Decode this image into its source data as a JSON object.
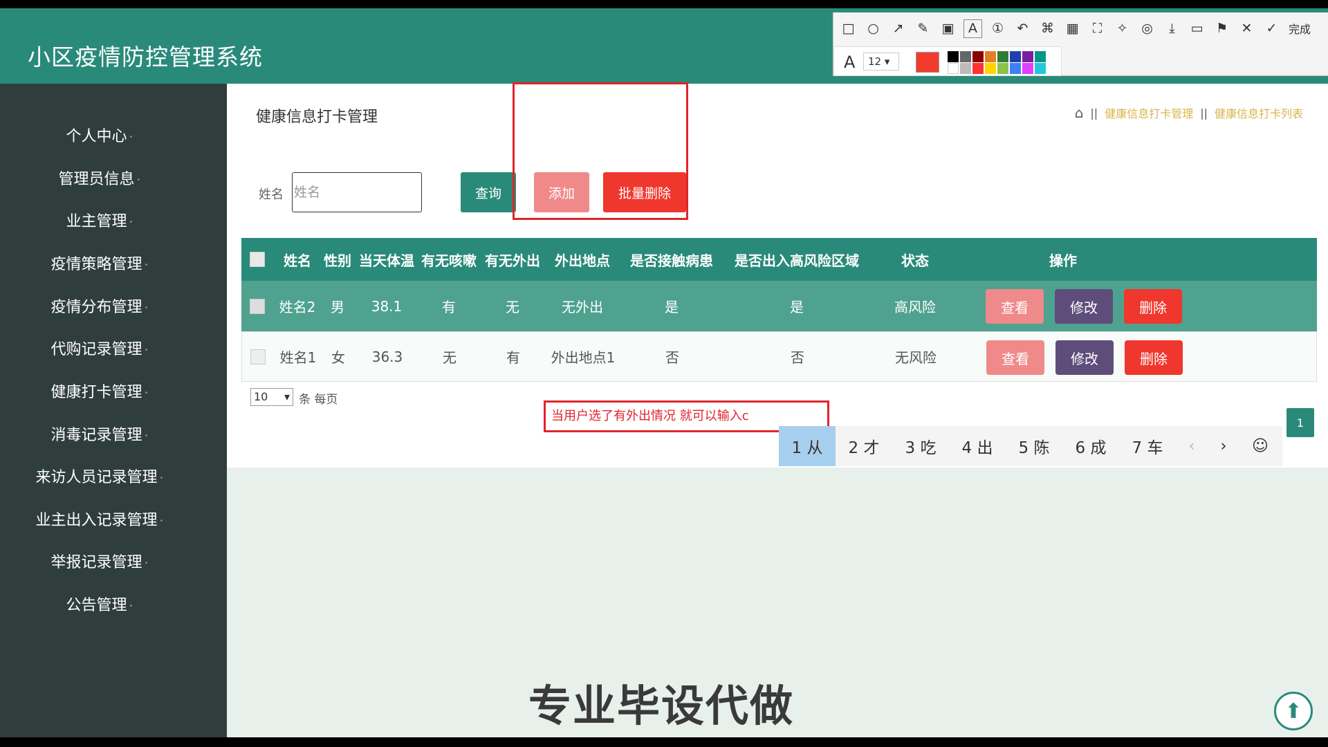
{
  "app": {
    "title": "小区疫情防控管理系统"
  },
  "sidebar": {
    "items": [
      {
        "label": "个人中心"
      },
      {
        "label": "管理员信息"
      },
      {
        "label": "业主管理"
      },
      {
        "label": "疫情策略管理"
      },
      {
        "label": "疫情分布管理"
      },
      {
        "label": "代购记录管理"
      },
      {
        "label": "健康打卡管理"
      },
      {
        "label": "消毒记录管理"
      },
      {
        "label": "来访人员记录管理"
      },
      {
        "label": "业主出入记录管理"
      },
      {
        "label": "举报记录管理"
      },
      {
        "label": "公告管理"
      }
    ]
  },
  "page": {
    "title": "健康信息打卡管理",
    "breadcrumb": [
      "健康信息打卡管理",
      "健康信息打卡列表"
    ]
  },
  "search": {
    "label": "姓名",
    "placeholder": "姓名",
    "query_label": "查询",
    "add_label": "添加",
    "batch_delete_label": "批量删除"
  },
  "table": {
    "headers": [
      "姓名",
      "性别",
      "当天体温",
      "有无咳嗽",
      "有无外出",
      "外出地点",
      "是否接触病患",
      "是否出入高风险区域",
      "状态",
      "操作"
    ],
    "rows": [
      {
        "name": "姓名2",
        "gender": "男",
        "temp": "38.1",
        "cough": "有",
        "out": "无",
        "place": "无外出",
        "contact": "是",
        "risk_area": "是",
        "status": "高风险"
      },
      {
        "name": "姓名1",
        "gender": "女",
        "temp": "36.3",
        "cough": "无",
        "out": "有",
        "place": "外出地点1",
        "contact": "否",
        "risk_area": "否",
        "status": "无风险"
      }
    ],
    "actions": {
      "view": "查看",
      "edit": "修改",
      "delete": "删除"
    }
  },
  "pagination": {
    "per_page": "10",
    "per_page_label": "条 每页",
    "current": "1"
  },
  "ime": {
    "input_text": "当用户选了有外出情况 就可以输入c",
    "candidates": [
      "1 从",
      "2 才",
      "3 吃",
      "4 出",
      "5 陈",
      "6 成",
      "7 车"
    ],
    "prev": "‹",
    "next": "›",
    "emoji": "☺"
  },
  "toolbar": {
    "done_label": "完成",
    "font_size": "12"
  },
  "watermark": "专业毕设代做",
  "colors": {
    "primary": "#2a8a7a",
    "sidebar": "#2f3e3d",
    "danger": "#f0372d",
    "pink": "#f08a8a",
    "purple": "#5e4d7a",
    "highlight": "#e0242b"
  }
}
